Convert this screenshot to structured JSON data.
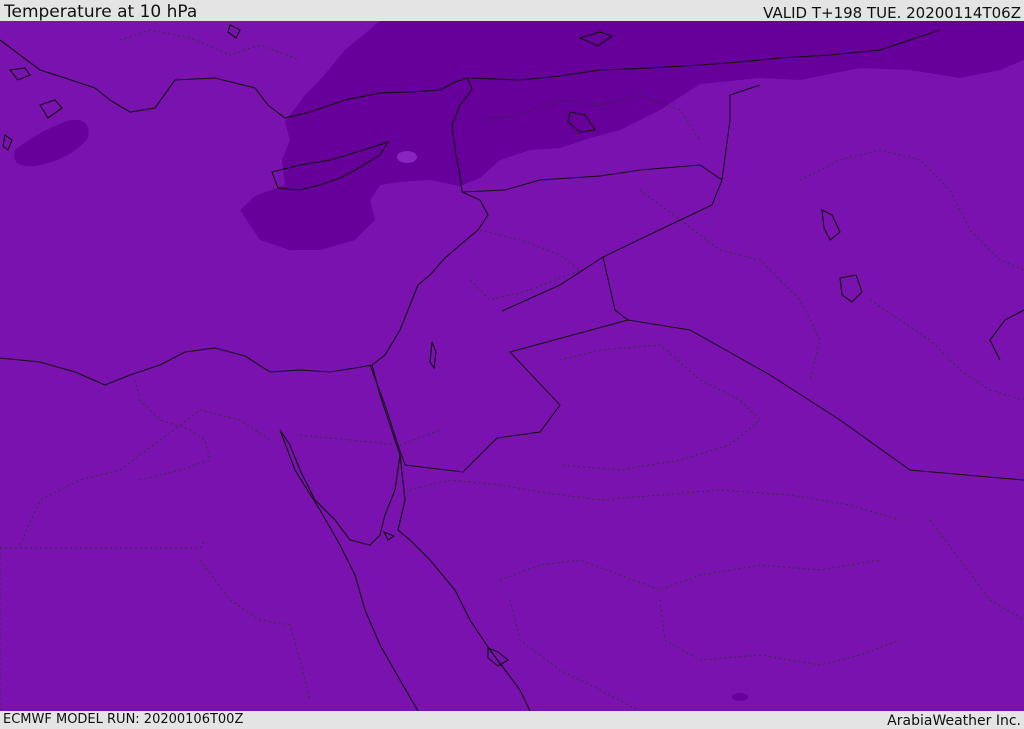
{
  "header": {
    "title": "Temperature at 10 hPa",
    "valid": "VALID T+198 TUE. 20200114T06Z"
  },
  "footer": {
    "model_run": "ECMWF MODEL RUN: 20200106T00Z",
    "credit": "ArabiaWeather Inc."
  },
  "map": {
    "colors": {
      "base_field": "#7a12b0",
      "cold_band": "#67009a",
      "coastline": "#111111",
      "border": "#111111",
      "internal_border": "#333333"
    }
  }
}
